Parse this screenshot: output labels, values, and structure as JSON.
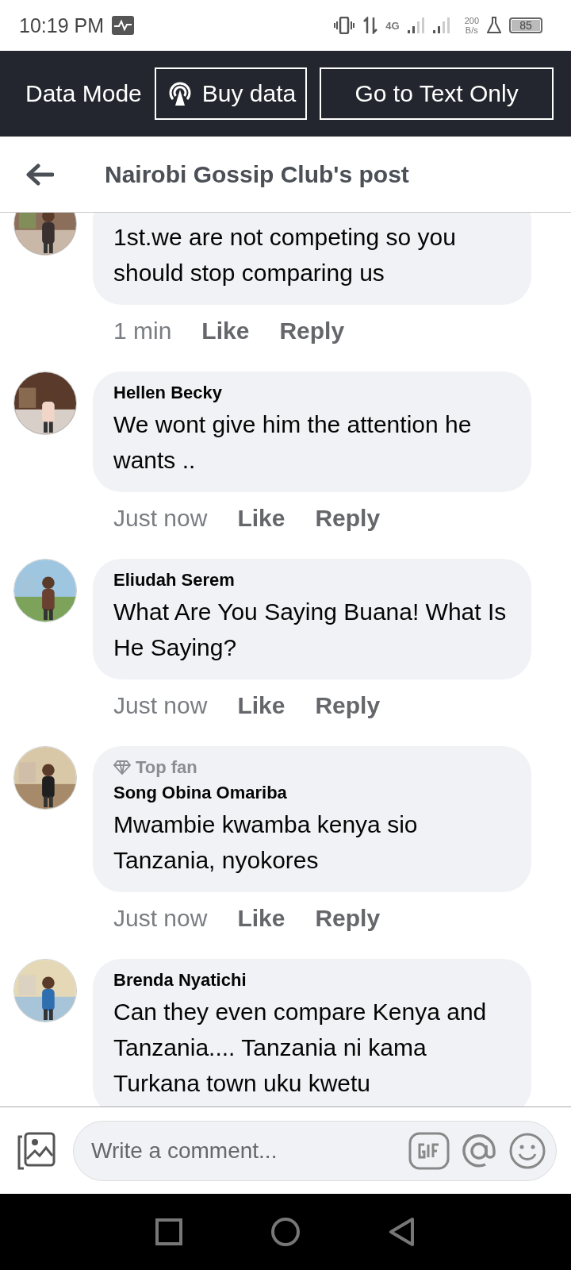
{
  "status_bar": {
    "time": "10:19 PM",
    "network": "4G",
    "speed_value": "200",
    "speed_unit": "B/s",
    "battery": "85"
  },
  "data_banner": {
    "label": "Data Mode",
    "buttons": [
      {
        "kind": "buy",
        "label": "Buy data"
      },
      {
        "kind": "text_only",
        "label": "Go to Text Only"
      }
    ]
  },
  "header": {
    "title": "Nairobi Gossip Club's post"
  },
  "comments": [
    {
      "text": "1st.we are not competing so you should stop comparing us",
      "time": "1 min",
      "like": "Like",
      "reply": "Reply",
      "cut_top": true
    },
    {
      "name": "Hellen Becky",
      "text": "We wont give him the attention he wants ..",
      "time": "Just now",
      "like": "Like",
      "reply": "Reply"
    },
    {
      "name": "Eliudah Serem",
      "text": "What Are You Saying Buana! What Is He Saying?",
      "time": "Just now",
      "like": "Like",
      "reply": "Reply"
    },
    {
      "badge": "Top fan",
      "name": "Song Obina Omariba",
      "text": "Mwambie kwamba kenya sio Tanzania, nyokores",
      "time": "Just now",
      "like": "Like",
      "reply": "Reply"
    },
    {
      "name": "Brenda Nyatichi",
      "text": "Can they even compare Kenya and Tanzania.... Tanzania ni kama Turkana town uku kwetu"
    }
  ],
  "composer": {
    "placeholder": "Write a comment..."
  }
}
